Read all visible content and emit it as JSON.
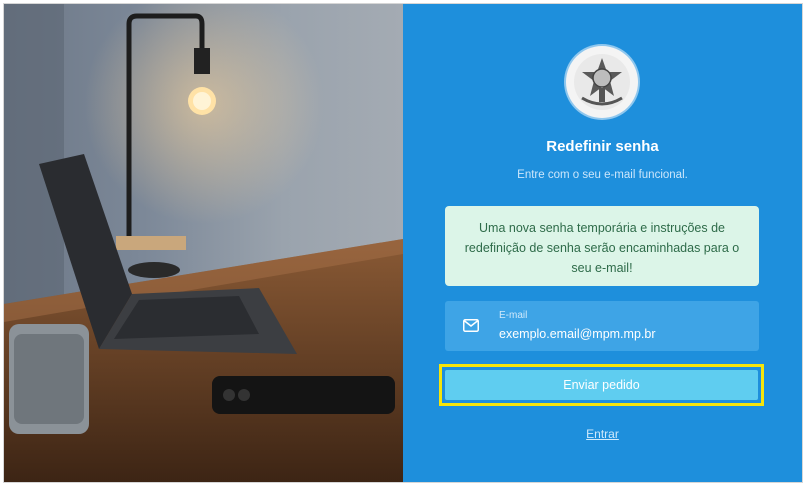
{
  "form": {
    "title": "Redefinir senha",
    "subtitle": "Entre com o seu e-mail funcional.",
    "alert": "Uma nova senha temporária e instruções de redefinição de senha serão encaminhadas para o seu e-mail!",
    "email": {
      "label": "E-mail",
      "value": "exemplo.email@mpm.mp.br",
      "icon": "mail-icon"
    },
    "submit_label": "Enviar pedido",
    "login_link": "Entrar"
  },
  "colors": {
    "panel_bg": "#1e8fdc",
    "button_bg": "#5fcdf0",
    "alert_bg": "#dcf5e8",
    "highlight": "#f5e50a"
  }
}
